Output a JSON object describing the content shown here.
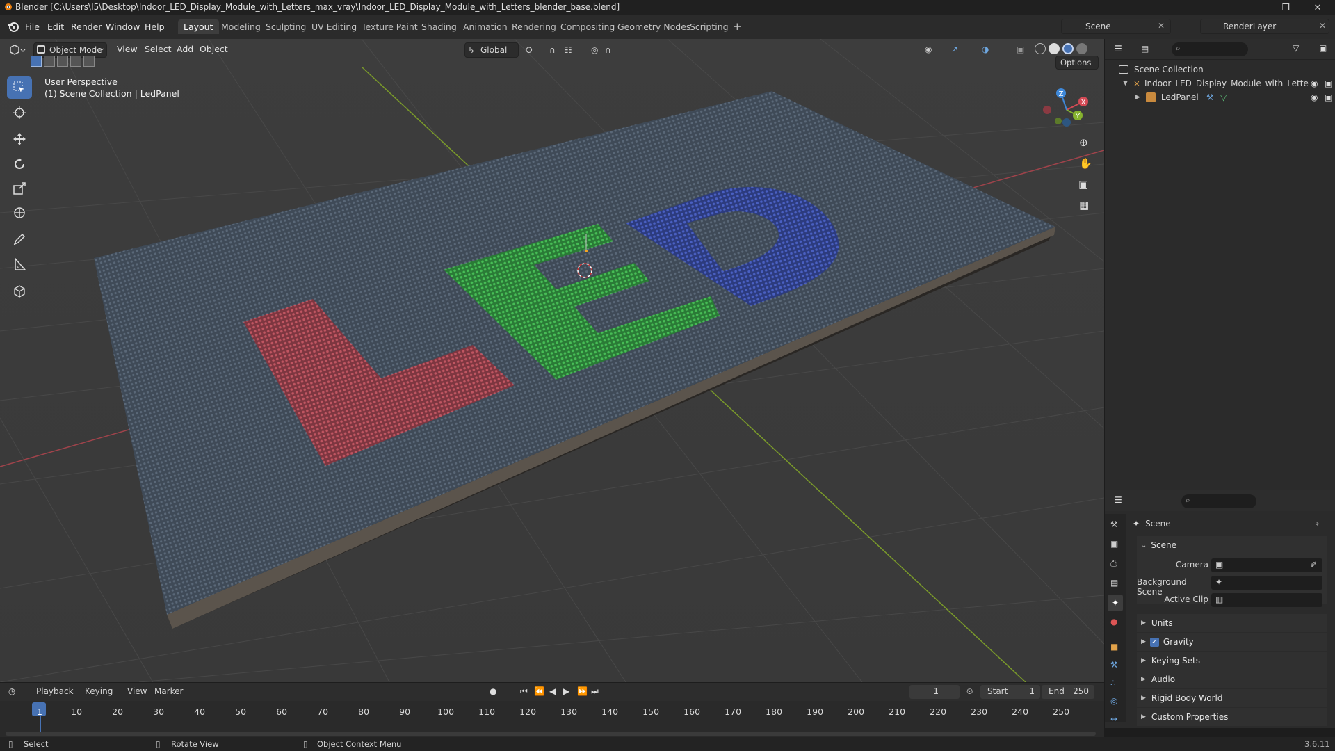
{
  "window": {
    "title": "Blender [C:\\Users\\I5\\Desktop\\Indoor_LED_Display_Module_with_Letters_max_vray\\Indoor_LED_Display_Module_with_Letters_blender_base.blend]"
  },
  "menu": [
    "File",
    "Edit",
    "Render",
    "Window",
    "Help"
  ],
  "workspaces": [
    "Layout",
    "Modeling",
    "Sculpting",
    "UV Editing",
    "Texture Paint",
    "Shading",
    "Animation",
    "Rendering",
    "Compositing",
    "Geometry Nodes",
    "Scripting"
  ],
  "active_workspace": "Layout",
  "scene_selector": {
    "value": "Scene"
  },
  "view_layer": {
    "value": "RenderLayer"
  },
  "viewport": {
    "mode": "Object Mode",
    "menus": [
      "View",
      "Select",
      "Add",
      "Object"
    ],
    "transform_orientation": "Global",
    "options_label": "Options",
    "overlay_line1": "User Perspective",
    "overlay_line2": "(1) Scene Collection | LedPanel",
    "gizmo_axes": {
      "x": "X",
      "y": "Y",
      "z": "Z"
    }
  },
  "outliner": {
    "root": "Scene Collection",
    "items": [
      {
        "label": "Indoor_LED_Display_Module_with_Lette"
      },
      {
        "label": "LedPanel"
      }
    ]
  },
  "properties": {
    "context_title": "Scene",
    "panel_title": "Scene",
    "fields": [
      {
        "label": "Camera"
      },
      {
        "label": "Background Scene"
      },
      {
        "label": "Active Clip"
      }
    ],
    "sections": [
      "Units",
      "Gravity",
      "Keying Sets",
      "Audio",
      "Rigid Body World",
      "Custom Properties"
    ],
    "gravity_checked": true
  },
  "timeline": {
    "menus": [
      "Playback",
      "Keying",
      "View",
      "Marker"
    ],
    "current_frame": "1",
    "start_label": "Start",
    "start_value": "1",
    "end_label": "End",
    "end_value": "250",
    "ticks": [
      "1",
      "10",
      "20",
      "30",
      "40",
      "50",
      "60",
      "70",
      "80",
      "90",
      "100",
      "110",
      "120",
      "130",
      "140",
      "150",
      "160",
      "170",
      "180",
      "190",
      "200",
      "210",
      "220",
      "230",
      "240",
      "250"
    ]
  },
  "statusbar": {
    "select": "Select",
    "rotate": "Rotate View",
    "context_menu": "Object Context Menu",
    "version": "3.6.11"
  },
  "colors": {
    "accent": "#4772b3",
    "led_red": "#a8454f",
    "led_green": "#3aa047",
    "led_blue": "#3b4fa3"
  }
}
